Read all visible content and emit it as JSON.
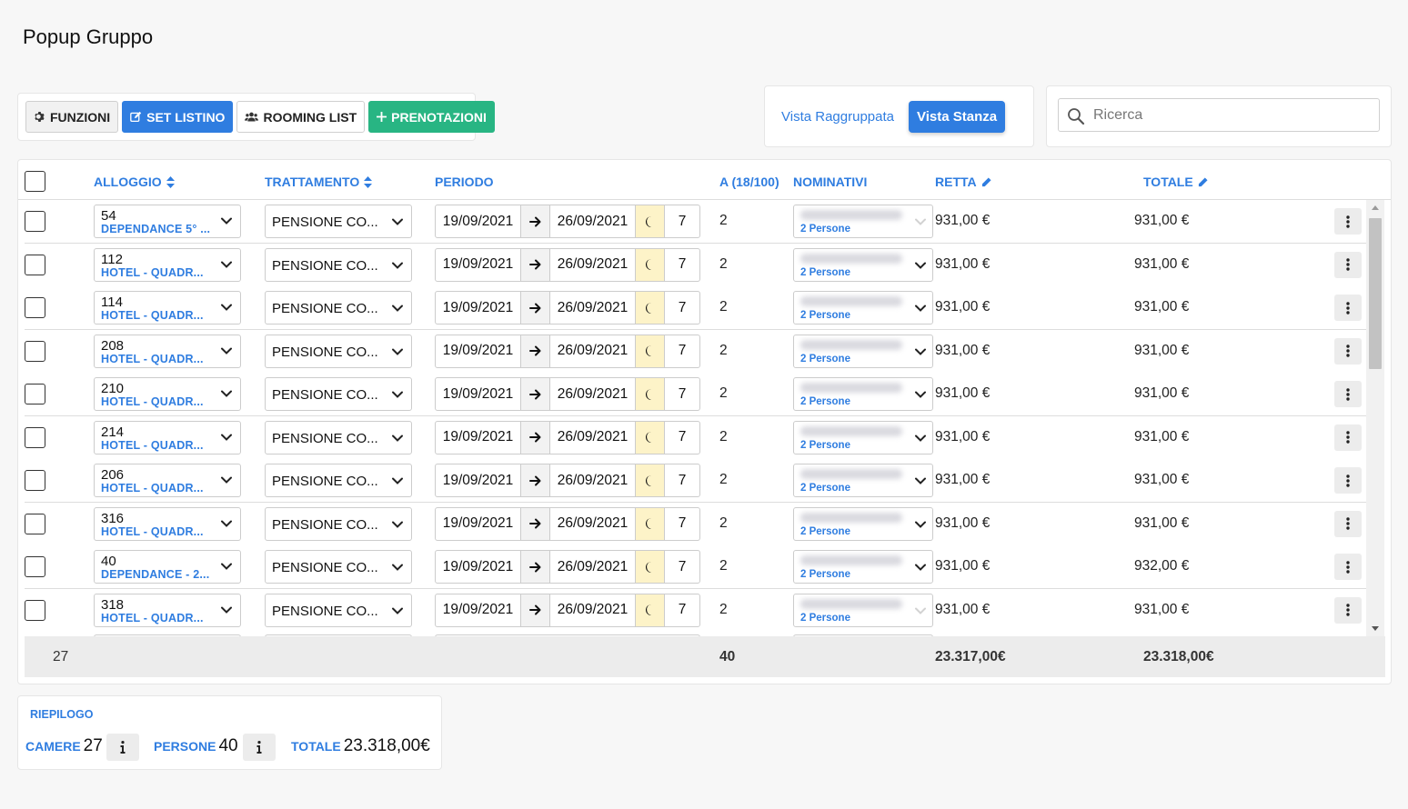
{
  "page": {
    "title": "Popup Gruppo"
  },
  "toolbar": {
    "funzioni": "FUNZIONI",
    "set_listino": "SET LISTINO",
    "rooming_list": "ROOMING LIST",
    "prenotazioni": "PRENOTAZIONI"
  },
  "views": {
    "grouped": "Vista Raggruppata",
    "room": "Vista Stanza"
  },
  "search": {
    "placeholder": "Ricerca"
  },
  "table": {
    "headers": {
      "alloggio": "ALLOGGIO",
      "trattamento": "TRATTAMENTO",
      "periodo": "PERIODO",
      "adulti": "A (18/100)",
      "nominativi": "NOMINATIVI",
      "retta": "RETTA",
      "totale": "TOTALE"
    },
    "rows": [
      {
        "room": "54",
        "type": "DEPENDANCE 5° ...",
        "treatment": "PENSIONE CO...",
        "from": "19/09/2021",
        "to": "26/09/2021",
        "nights": "7",
        "adults": "2",
        "people": "2 Persone",
        "retta": "931,00 €",
        "totale": "931,00 €"
      },
      {
        "room": "112",
        "type": "HOTEL - QUADR...",
        "treatment": "PENSIONE CO...",
        "from": "19/09/2021",
        "to": "26/09/2021",
        "nights": "7",
        "adults": "2",
        "people": "2 Persone",
        "retta": "931,00 €",
        "totale": "931,00 €"
      },
      {
        "room": "114",
        "type": "HOTEL - QUADR...",
        "treatment": "PENSIONE CO...",
        "from": "19/09/2021",
        "to": "26/09/2021",
        "nights": "7",
        "adults": "2",
        "people": "2 Persone",
        "retta": "931,00 €",
        "totale": "931,00 €"
      },
      {
        "room": "208",
        "type": "HOTEL - QUADR...",
        "treatment": "PENSIONE CO...",
        "from": "19/09/2021",
        "to": "26/09/2021",
        "nights": "7",
        "adults": "2",
        "people": "2 Persone",
        "retta": "931,00 €",
        "totale": "931,00 €"
      },
      {
        "room": "210",
        "type": "HOTEL - QUADR...",
        "treatment": "PENSIONE CO...",
        "from": "19/09/2021",
        "to": "26/09/2021",
        "nights": "7",
        "adults": "2",
        "people": "2 Persone",
        "retta": "931,00 €",
        "totale": "931,00 €"
      },
      {
        "room": "214",
        "type": "HOTEL - QUADR...",
        "treatment": "PENSIONE CO...",
        "from": "19/09/2021",
        "to": "26/09/2021",
        "nights": "7",
        "adults": "2",
        "people": "2 Persone",
        "retta": "931,00 €",
        "totale": "931,00 €"
      },
      {
        "room": "206",
        "type": "HOTEL - QUADR...",
        "treatment": "PENSIONE CO...",
        "from": "19/09/2021",
        "to": "26/09/2021",
        "nights": "7",
        "adults": "2",
        "people": "2 Persone",
        "retta": "931,00 €",
        "totale": "931,00 €"
      },
      {
        "room": "316",
        "type": "HOTEL - QUADR...",
        "treatment": "PENSIONE CO...",
        "from": "19/09/2021",
        "to": "26/09/2021",
        "nights": "7",
        "adults": "2",
        "people": "2 Persone",
        "retta": "931,00 €",
        "totale": "931,00 €"
      },
      {
        "room": "40",
        "type": "DEPENDANCE - 2...",
        "treatment": "PENSIONE CO...",
        "from": "19/09/2021",
        "to": "26/09/2021",
        "nights": "7",
        "adults": "2",
        "people": "2 Persone",
        "retta": "931,00 €",
        "totale": "932,00 €"
      },
      {
        "room": "318",
        "type": "HOTEL - QUADR...",
        "treatment": "PENSIONE CO...",
        "from": "19/09/2021",
        "to": "26/09/2021",
        "nights": "7",
        "adults": "2",
        "people": "2 Persone",
        "retta": "931,00 €",
        "totale": "931,00 €"
      }
    ],
    "footer": {
      "rooms": "27",
      "adults": "40",
      "retta": "23.317,00€",
      "totale": "23.318,00€"
    }
  },
  "summary": {
    "title": "RIEPILOGO",
    "camere_label": "CAMERE",
    "camere": "27",
    "persone_label": "PERSONE",
    "persone": "40",
    "totale_label": "TOTALE",
    "totale": "23.318,00€"
  },
  "colors": {
    "accent": "#2f7de0",
    "success": "#28b583",
    "moon_bg": "#fdf3c8"
  }
}
